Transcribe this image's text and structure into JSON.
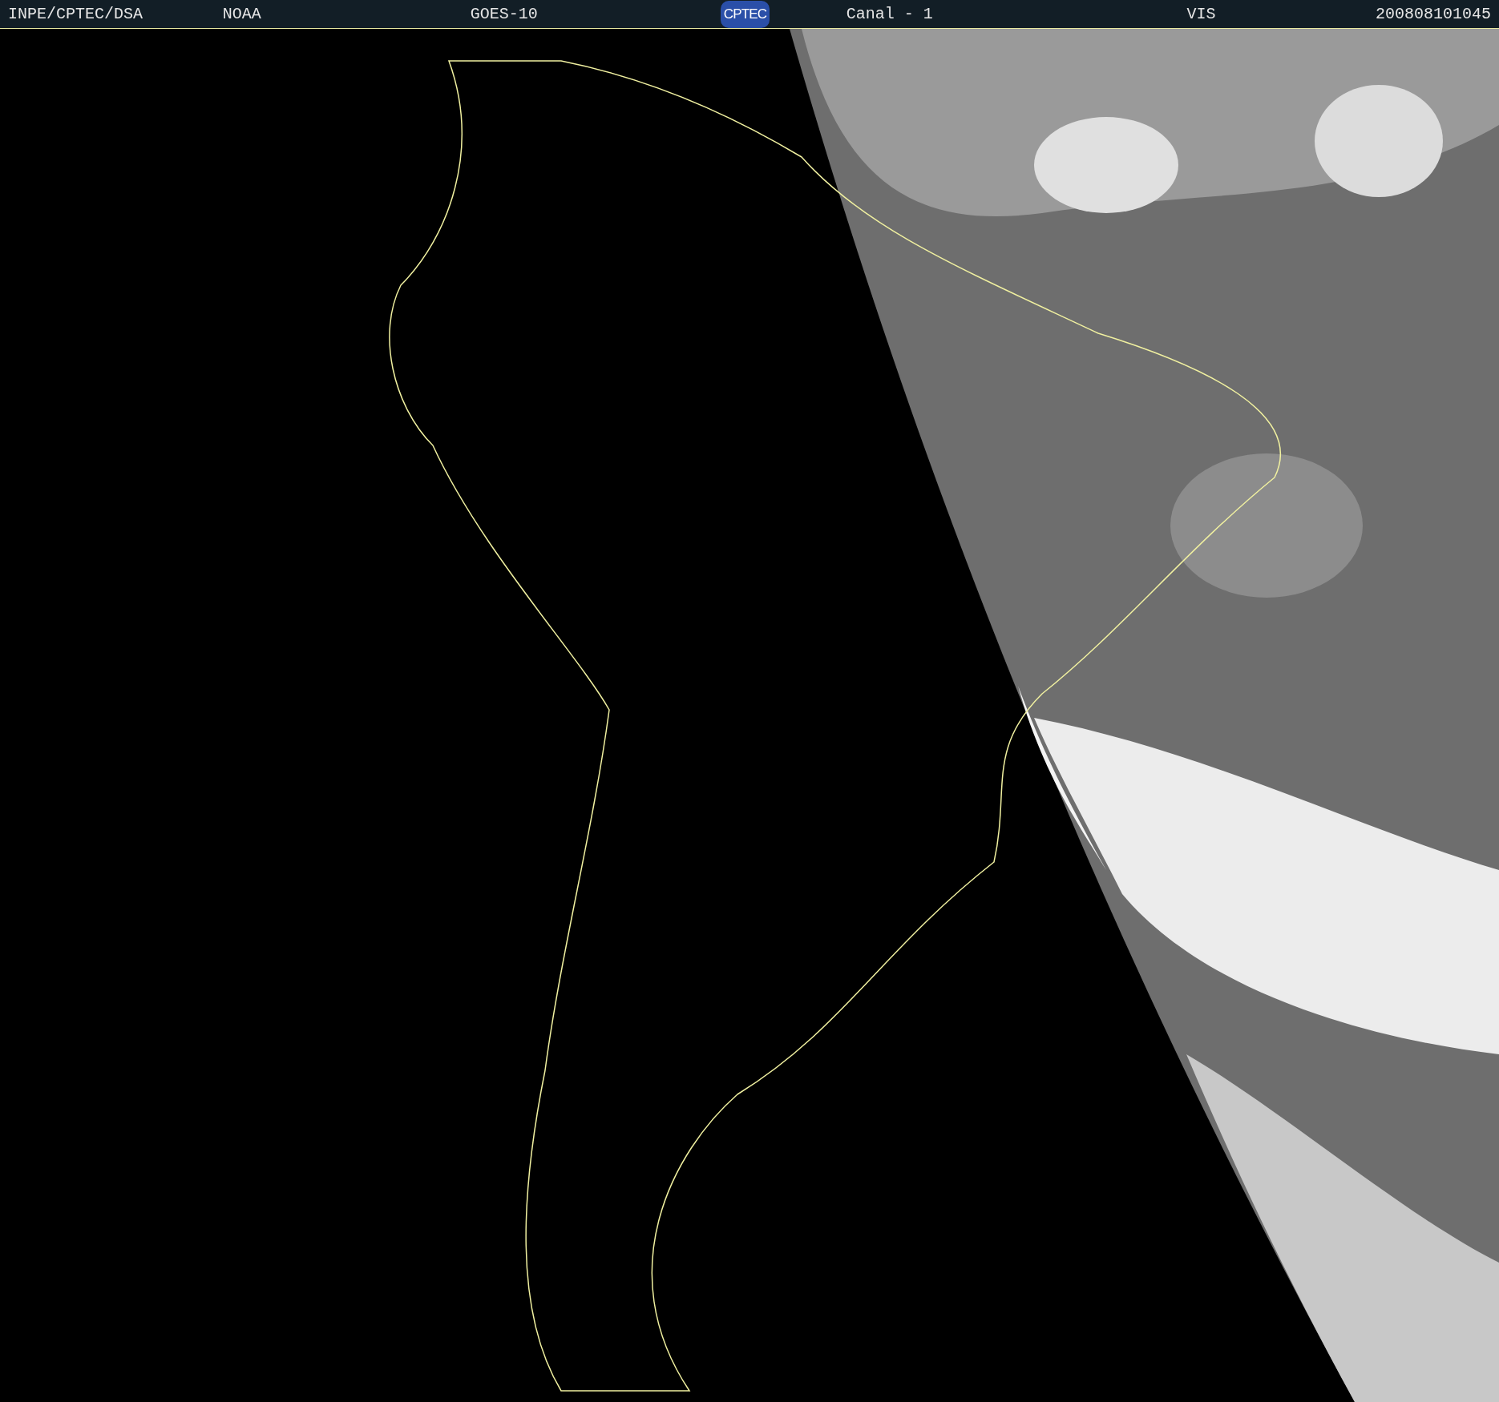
{
  "header": {
    "items": [
      {
        "kind": "text",
        "text": "INPE/CPTEC/DSA"
      },
      {
        "kind": "text",
        "text": "NOAA"
      },
      {
        "kind": "text",
        "text": "GOES-10"
      },
      {
        "kind": "logo",
        "text": "CPTEC"
      },
      {
        "kind": "text",
        "text": "Canal - 1"
      },
      {
        "kind": "text",
        "text": "VIS"
      },
      {
        "kind": "text",
        "text": "200808101045"
      }
    ]
  }
}
